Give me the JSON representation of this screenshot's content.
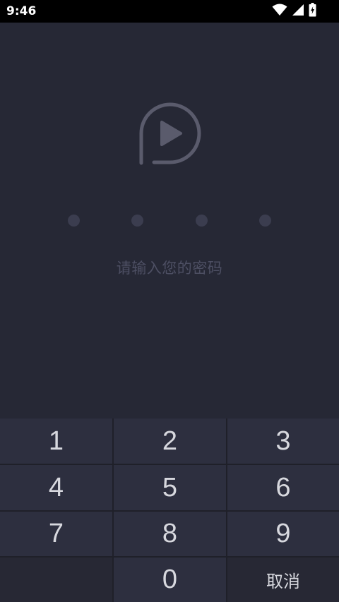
{
  "status_bar": {
    "time": "9:46",
    "icons": [
      "wifi-icon",
      "cellular-signal-icon",
      "battery-charging-icon"
    ]
  },
  "logo": {
    "icon": "play-p-logo-icon"
  },
  "pin": {
    "length": 4,
    "entered": 0
  },
  "prompt": "请输入您的密码",
  "keypad": {
    "keys": [
      {
        "label": "1"
      },
      {
        "label": "2"
      },
      {
        "label": "3"
      },
      {
        "label": "4"
      },
      {
        "label": "5"
      },
      {
        "label": "6"
      },
      {
        "label": "7"
      },
      {
        "label": "8"
      },
      {
        "label": "9"
      },
      {
        "label": ""
      },
      {
        "label": "0"
      },
      {
        "label": "取消"
      }
    ]
  },
  "colors": {
    "background": "#262835",
    "keypad_key": "#2d2f3f",
    "keypad_key_dark": "#272834",
    "pin_dot": "#3b3d4f",
    "prompt_text": "#4d4f63",
    "logo": "#5a5b6c",
    "key_text": "#d7d8de"
  }
}
